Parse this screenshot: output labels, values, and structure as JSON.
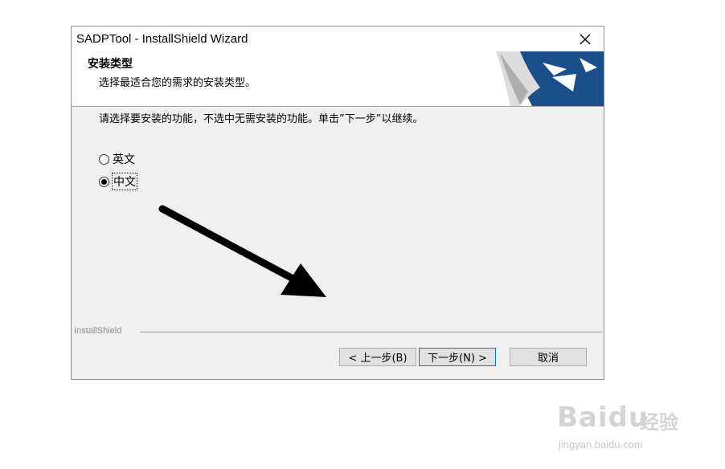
{
  "window": {
    "title": "SADPTool - InstallShield Wizard"
  },
  "header": {
    "title": "安装类型",
    "subtitle": "选择最适合您的需求的安装类型。"
  },
  "instruction": "请选择要安装的功能，不选中无需安装的功能。单击”下一步”以继续。",
  "options": [
    {
      "label": "英文",
      "checked": false
    },
    {
      "label": "中文",
      "checked": true
    }
  ],
  "footer": {
    "brand": "InstallShield"
  },
  "buttons": {
    "back": "< 上一步(B)",
    "next": "下一步(N) >",
    "cancel": "取消"
  },
  "watermark": {
    "logo": "Bai",
    "logo_suffix": "du",
    "text": "经验",
    "url": "jingyan.baidu.com"
  },
  "colors": {
    "accent": "#0078d7",
    "logo_blue": "#1a4f8c"
  }
}
